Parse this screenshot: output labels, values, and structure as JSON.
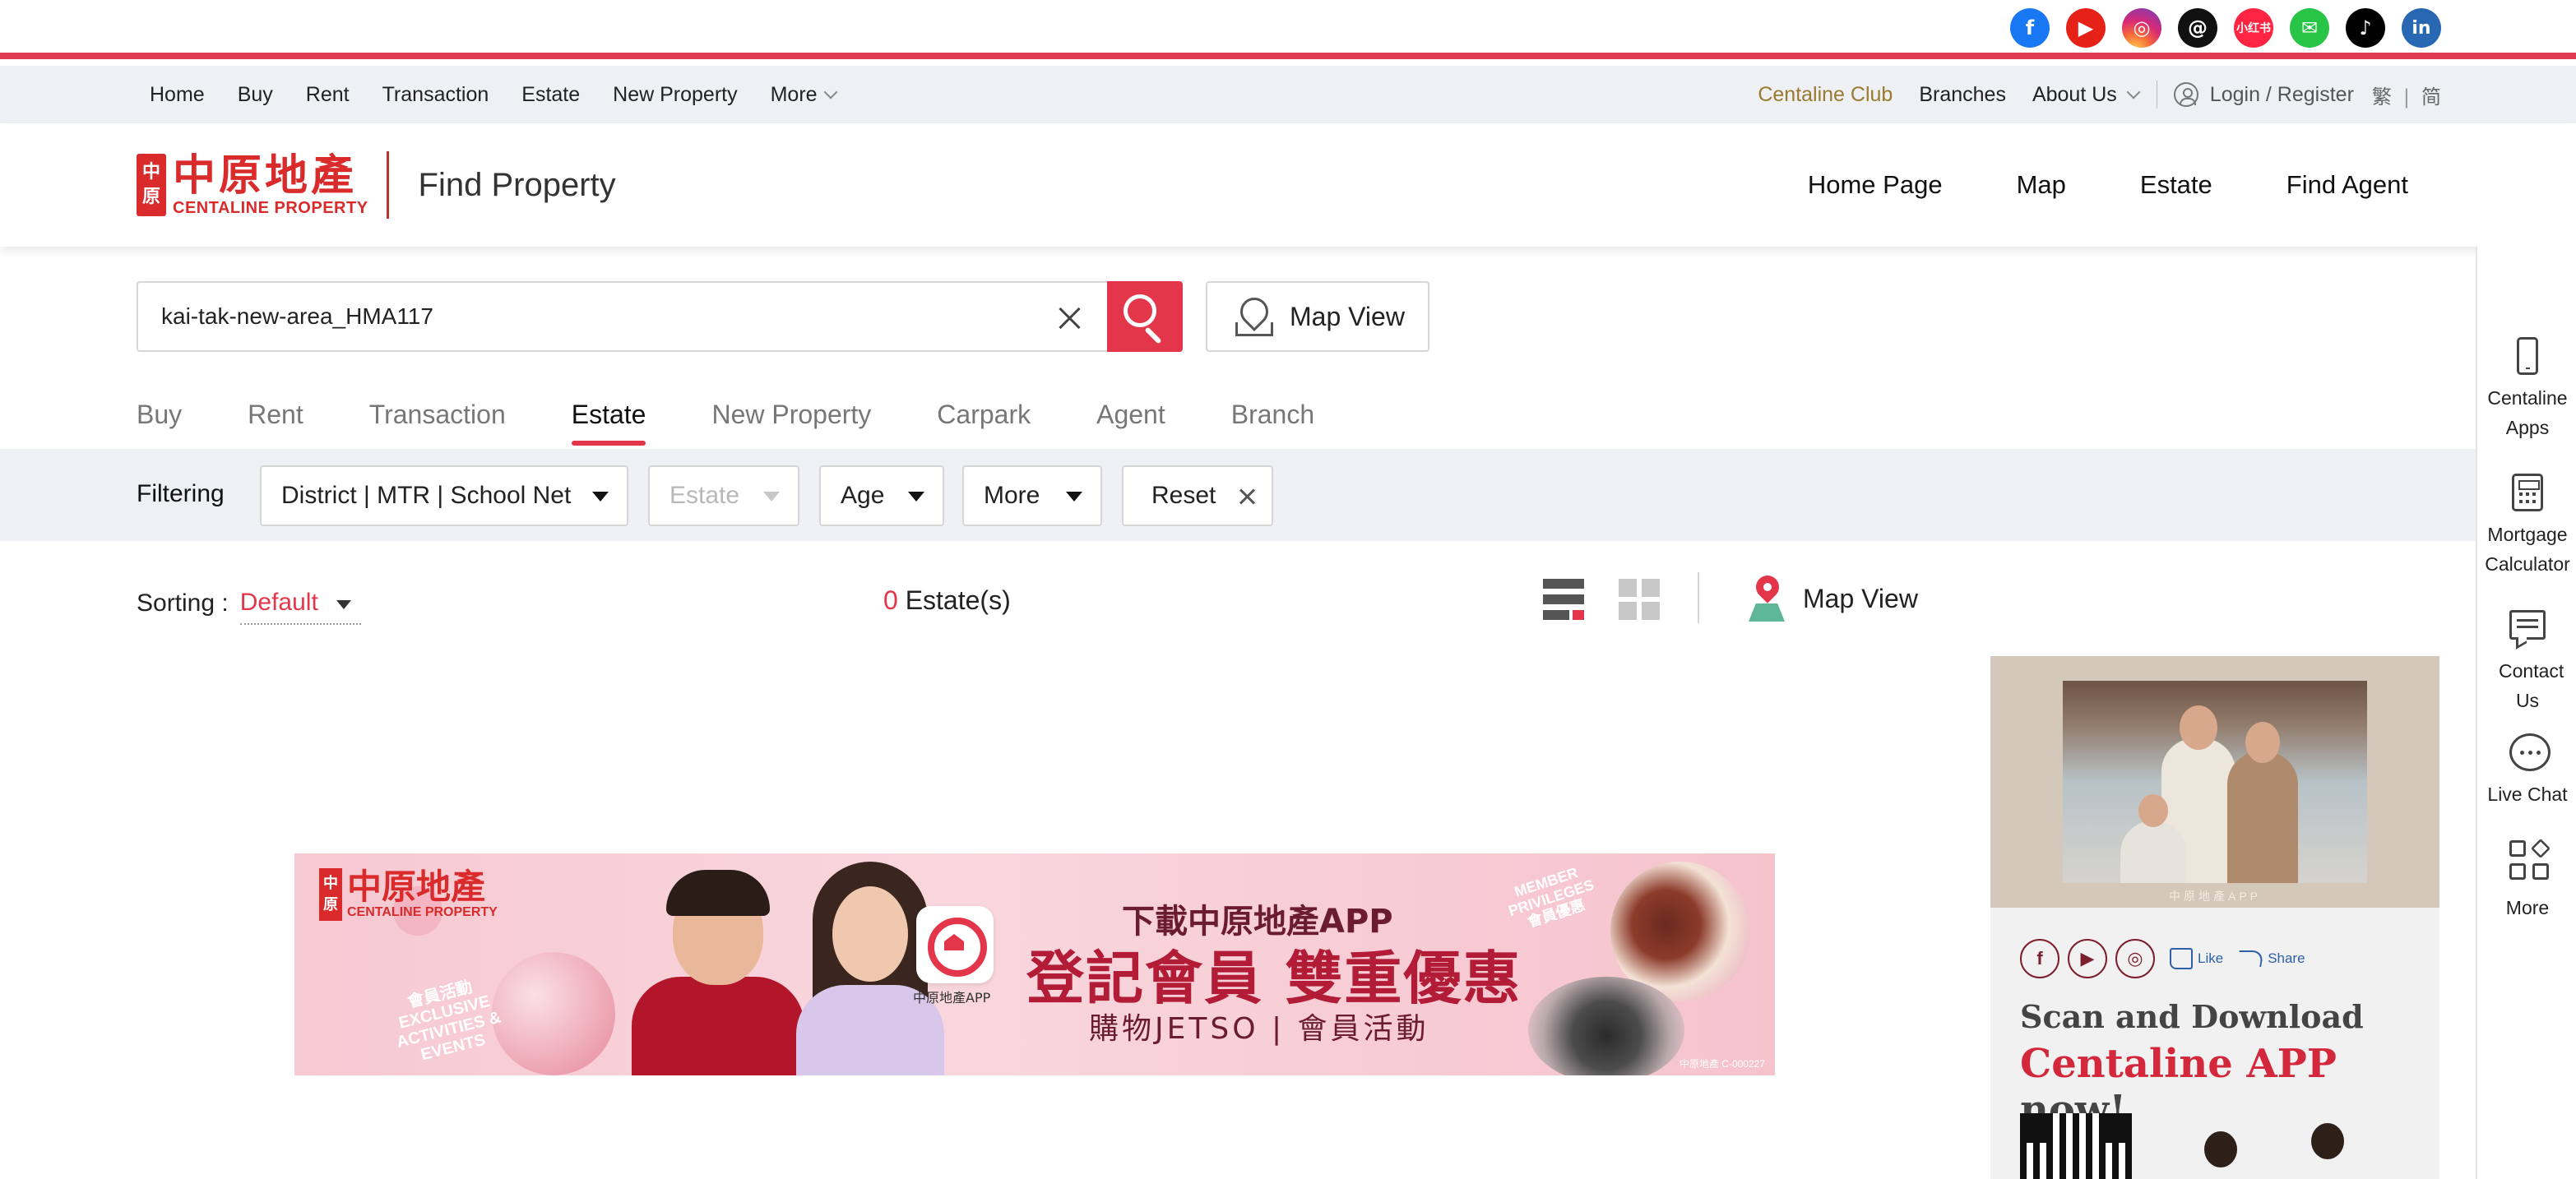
{
  "social": {
    "icons": [
      "facebook-icon",
      "youtube-icon",
      "instagram-icon",
      "threads-icon",
      "xiaohongshu-icon",
      "wechat-icon",
      "tiktok-icon",
      "linkedin-icon"
    ],
    "xiaohongshu_label": "小红书",
    "linkedin_label": "in"
  },
  "subnav": {
    "items": [
      "Home",
      "Buy",
      "Rent",
      "Transaction",
      "Estate",
      "New Property"
    ],
    "more": "More",
    "club": "Centaline Club",
    "branches": "Branches",
    "about": "About Us",
    "login": "Login / Register",
    "lang_trad": "繁",
    "lang_sep": "|",
    "lang_simp": "简"
  },
  "header": {
    "logo_cn": "中原地產",
    "logo_mark_top": "中",
    "logo_mark_bottom": "原",
    "logo_en": "CENTALINE PROPERTY",
    "title": "Find Property",
    "nav": [
      "Home Page",
      "Map",
      "Estate",
      "Find Agent"
    ]
  },
  "rail": {
    "items": [
      "Centaline Apps",
      "Mortgage Calculator",
      "Contact Us",
      "Live Chat",
      "More"
    ]
  },
  "search": {
    "value": "kai-tak-new-area_HMA117",
    "map_view": "Map View"
  },
  "tabs": {
    "items": [
      "Buy",
      "Rent",
      "Transaction",
      "Estate",
      "New Property",
      "Carpark",
      "Agent",
      "Branch"
    ],
    "active": "Estate"
  },
  "filters": {
    "label": "Filtering",
    "district": "District | MTR | School Net",
    "estate": "Estate",
    "age": "Age",
    "more": "More",
    "reset": "Reset"
  },
  "results": {
    "sorting_label": "Sorting :",
    "sorting_value": "Default",
    "count": "0",
    "count_suffix": "Estate(s)",
    "map_view": "Map View",
    "colors": {
      "accent": "#e3364b",
      "brand": "#d92b2b"
    }
  },
  "banner": {
    "logo_cn": "中原地產",
    "logo_mark_top": "中",
    "logo_mark_bottom": "原",
    "logo_en": "CENTALINE PROPERTY",
    "exclusive": "會員活動 EXCLUSIVE ACTIVITIES & EVENTS",
    "app_caption": "中原地產APP",
    "line1": "下載中原地產APP",
    "line2": "登記會員 雙重優惠",
    "line3": "購物JETSO | 會員活動",
    "member": "MEMBER PRIVILEGES 會員優惠",
    "code": "中原地產 C-000227"
  },
  "side_ad": {
    "tagline": "中原地產APP",
    "like": "Like",
    "share": "Share",
    "scan": "Scan and Download",
    "app_red": "Centaline APP",
    "app_rest": " now!"
  }
}
